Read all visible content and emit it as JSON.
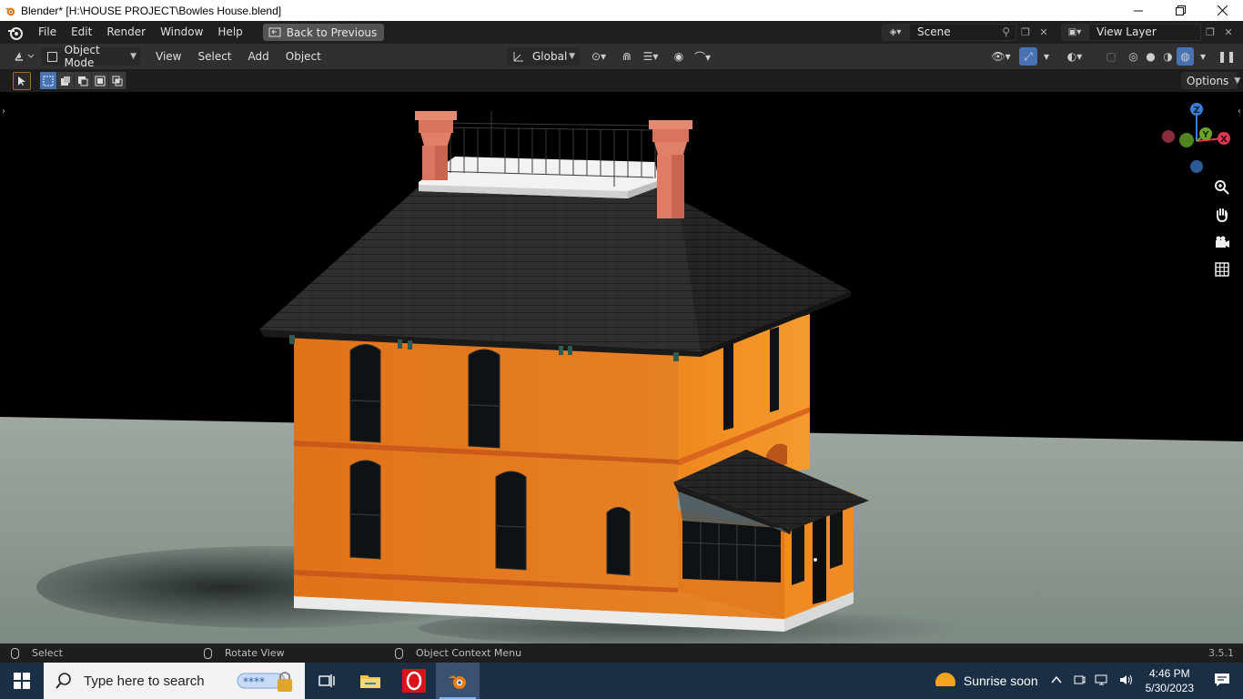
{
  "window": {
    "title": "Blender* [H:\\HOUSE PROJECT\\Bowles House.blend]",
    "controls": [
      "minimize",
      "restore",
      "close"
    ]
  },
  "menubar": {
    "items": [
      "File",
      "Edit",
      "Render",
      "Window",
      "Help"
    ],
    "back_button": "Back to Previous",
    "scene": "Scene",
    "view_layer": "View Layer"
  },
  "viewport_header": {
    "mode": "Object Mode",
    "menus": [
      "View",
      "Select",
      "Add",
      "Object"
    ],
    "orientation": "Global"
  },
  "toolbar": {
    "options_label": "Options"
  },
  "gizmo": {
    "axes": [
      "Z",
      "Y",
      "X"
    ],
    "colors": {
      "x": "#e0394f",
      "y": "#6aa32b",
      "z": "#3a7ed6"
    }
  },
  "statusbar": {
    "left": "Select",
    "middle": "Rotate View",
    "right": "Object Context Menu",
    "version": "3.5.1"
  },
  "taskbar": {
    "search_placeholder": "Type here to search",
    "weather": "Sunrise soon",
    "time": "4:46 PM",
    "date": "5/30/2023"
  }
}
